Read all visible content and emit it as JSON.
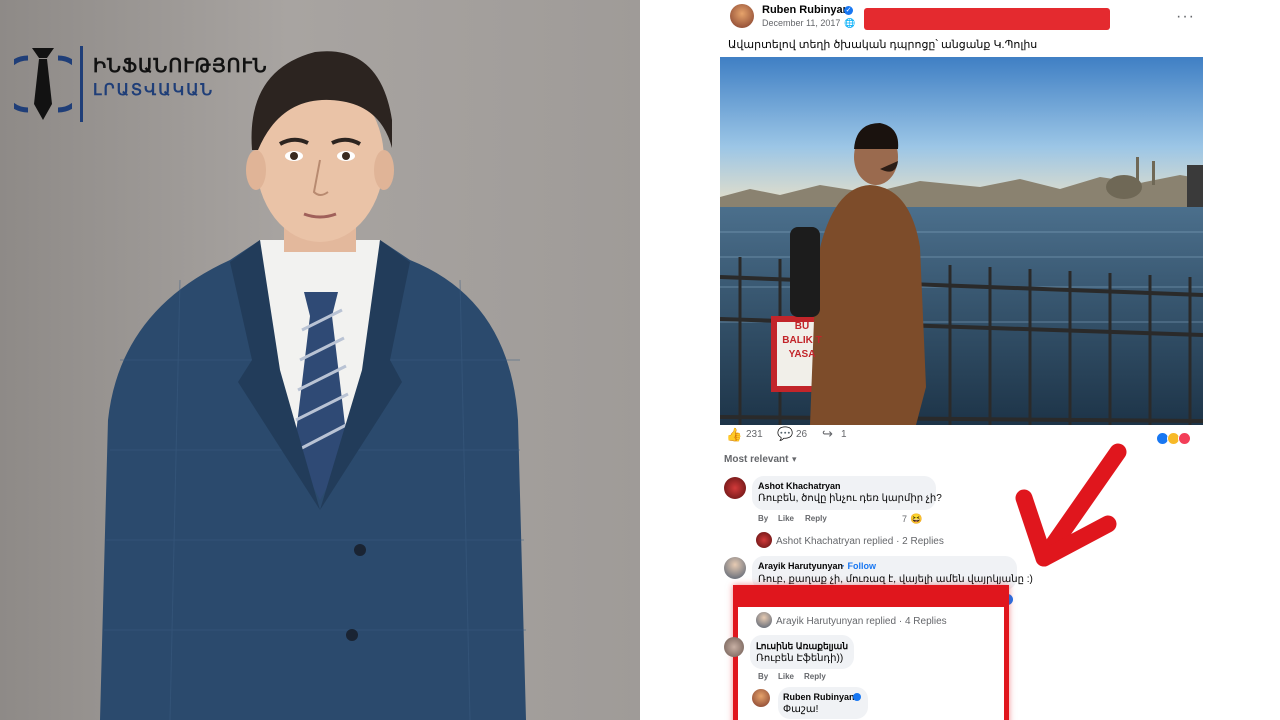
{
  "left_panel": {
    "logo": {
      "line1": "ԻՆՖԱՆՈՒԹՅՈՒՆ",
      "line2": "ԼՐԱՏՎԱԿԱՆ",
      "icon": "tie-in-circle-icon",
      "brand_color": "#1f3e78"
    }
  },
  "post": {
    "author": "Ruben Rubinyan",
    "date": "December 11, 2017",
    "audience_icon": "globe-icon",
    "more_icon": "ellipsis-icon",
    "text": "Ավարտելով տեղի ծխական դպրոցը՝ անցանք Կ.Պոլիս",
    "photo_sign": [
      "BU",
      "BALIK T",
      "YASA"
    ],
    "stats": {
      "likes": "231",
      "comments": "26",
      "shares": "1"
    },
    "sort_label": "Most relevant"
  },
  "comments": [
    {
      "name": "Ashot Khachatryan",
      "text": "Ռուբեն, ծովը ինչու դեռ կարմիր չի?",
      "actions": [
        "By",
        "Like",
        "Reply"
      ],
      "reaction_count": "7",
      "replied_line": "Ashot Khachatryan replied · 2 Replies"
    },
    {
      "name": "Arayik Harutyunyan",
      "follow": "· Follow",
      "text": "Ռուբ, քաղաք չի, մուռազ է, վայելի ամեն վայրկյանը :)",
      "replied_line": "Arayik Harutyunyan replied · 4 Replies"
    },
    {
      "name": "Լուսինե Առաքելյան",
      "text": "Ռուբեն Էֆենդի))",
      "actions": [
        "By",
        "Like",
        "Reply"
      ]
    },
    {
      "name": "Ruben Rubinyan",
      "text": "Փաշա!"
    }
  ],
  "colors": {
    "facebook_blue": "#1877f2",
    "highlight_red": "#e0161d"
  }
}
